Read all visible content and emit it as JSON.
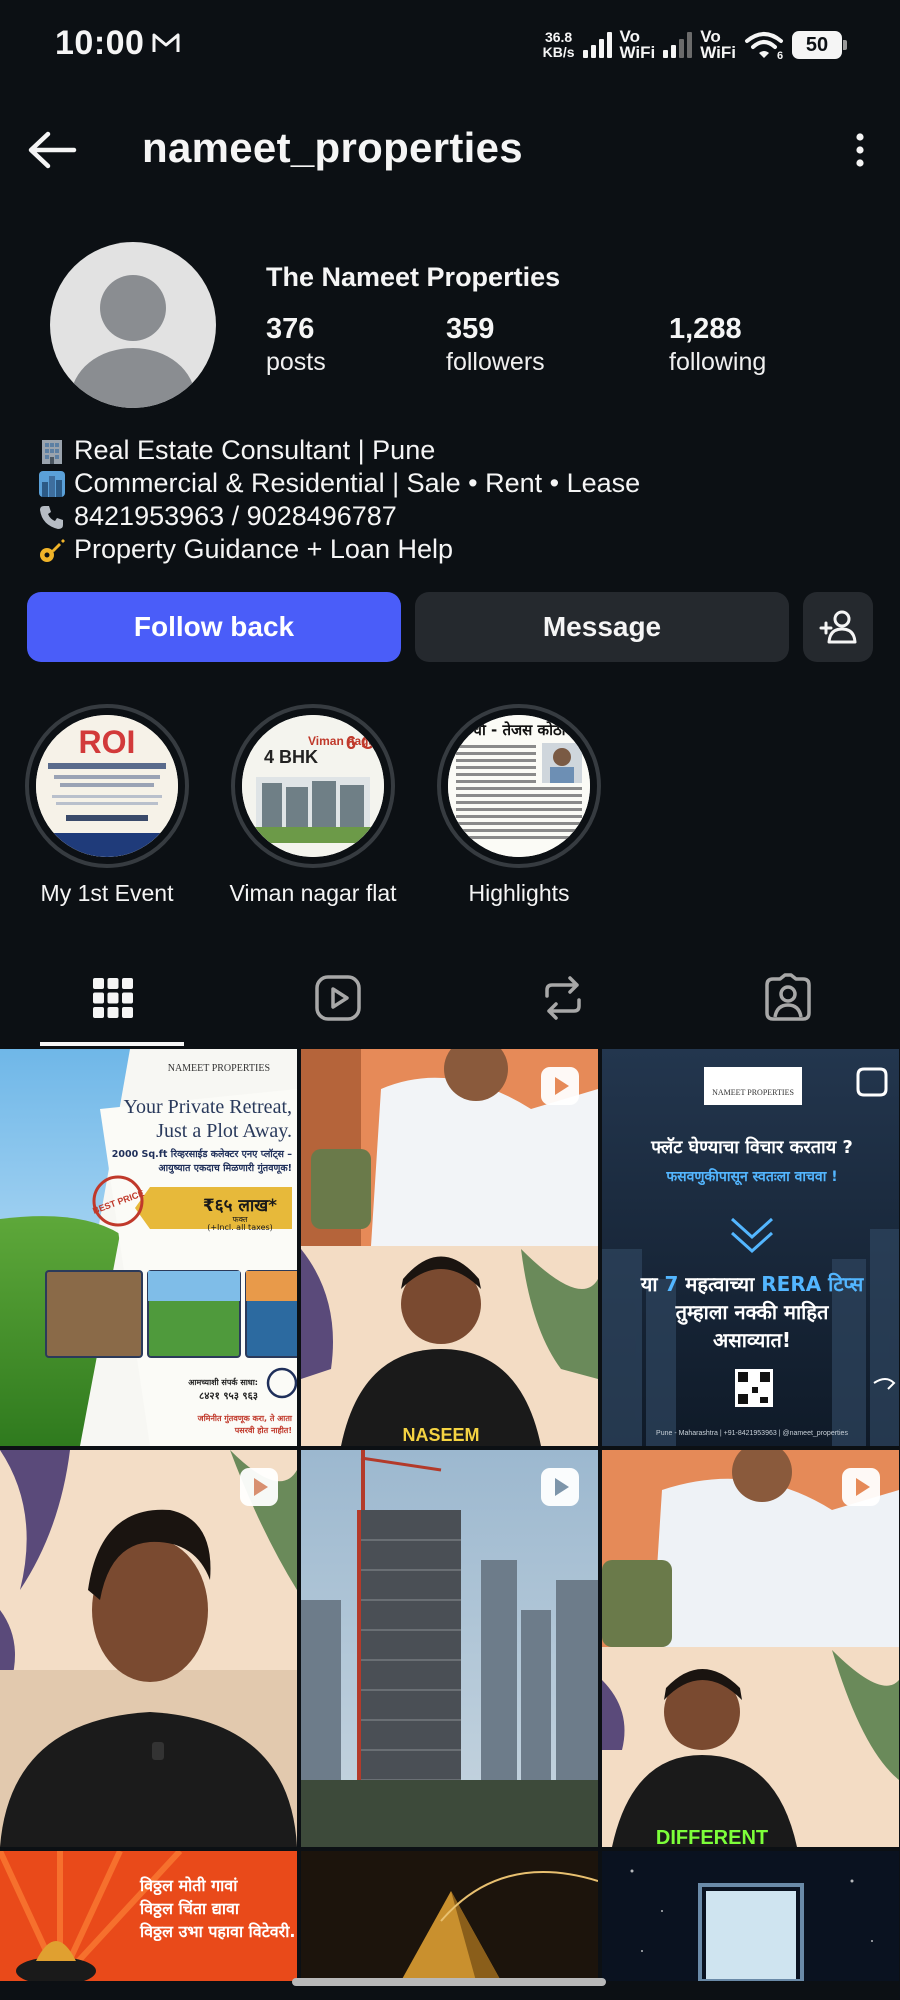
{
  "status_bar": {
    "time": "10:00",
    "net_speed_value": "36.8",
    "net_speed_unit": "KB/s",
    "vowifi_1_top": "Vo",
    "vowifi_1_bottom": "WiFi",
    "vowifi_2_top": "Vo",
    "vowifi_2_bottom": "WiFi",
    "sim2_sub": "6",
    "battery": "50"
  },
  "header": {
    "username": "nameet_properties"
  },
  "profile": {
    "display_name": "The Nameet Properties",
    "stats": [
      {
        "count": "376",
        "label": "posts"
      },
      {
        "count": "359",
        "label": "followers"
      },
      {
        "count": "1,288",
        "label": "following"
      }
    ],
    "bio": [
      {
        "emoji": "office-building-icon",
        "text": "Real Estate Consultant | Pune"
      },
      {
        "emoji": "cityscape-icon",
        "text": "Commercial & Residential | Sale • Rent • Lease"
      },
      {
        "emoji": "phone-icon",
        "text": "8421953963 / 9028496787"
      },
      {
        "emoji": "key-icon",
        "text": "Property Guidance + Loan Help"
      }
    ]
  },
  "actions": {
    "follow_back": "Follow back",
    "message": "Message"
  },
  "highlights": [
    {
      "label": "My 1st Event",
      "cover_text": "ROI"
    },
    {
      "label": "Viman nagar flat",
      "cover_text": "4 BHK",
      "cover_text_2": "Viman nagar",
      "cover_text_3": "6 Cr."
    },
    {
      "label": "Highlights",
      "cover_text": "र्चा - तेजस कोठा"
    }
  ],
  "tabs": [
    {
      "name": "grid",
      "icon": "grid-icon",
      "active": true
    },
    {
      "name": "reels",
      "icon": "reels-icon",
      "active": false
    },
    {
      "name": "reposts",
      "icon": "repost-icon",
      "active": false
    },
    {
      "name": "tagged",
      "icon": "tagged-icon",
      "active": false
    }
  ],
  "posts": {
    "p1": {
      "brand": "NAMEET PROPERTIES",
      "headline_1": "Your Private Retreat,",
      "headline_2": "Just a Plot Away.",
      "sub": "2000 Sq.ft रिव्हरसाईड कलेक्टर एनए प्लॉट्स –",
      "sub_2": "आयुष्यात एकदाच मिळणारी गुंतवणूक!",
      "price": "₹६५ लाख*",
      "price_sub": "फक्त",
      "price_note": "(+Incl. all taxes)",
      "badge": "BEST PRICE",
      "contact": "आमच्याशी संपर्क साधा:",
      "contact_num": "८४२१ ९५३ ९६३",
      "footer": "जमिनीत गुंतवणूक करा, ते आता",
      "footer_2": "पसरवी होत नाहीत!"
    },
    "p3": {
      "brand": "NAMEET PROPERTIES",
      "line1": "फ्लॅट घेण्याचा विचार करताय ?",
      "line2": "फसवणुकीपासून स्वतःला वाचवा !",
      "line3_a": "या",
      "line3_num": "7",
      "line3_b": "महत्वाच्या",
      "line3_c": "RERA",
      "line3_d": "टिप्स",
      "line4": "तुम्हाला नक्की माहित",
      "line5": "असाव्यात!",
      "footer": "Pune - Maharashtra | +91-8421953963 | @nameet_properties"
    },
    "p2": {
      "caption": "NASEEM"
    },
    "p6": {
      "caption": "DIFFERENT"
    },
    "p7": {
      "line1": "विठ्ठल मोती गावां",
      "line2": "विठ्ठल चिंता द्यावा",
      "line3": "विठ्ठल उभा पहावा विटेवरी..."
    }
  },
  "colors": {
    "background": "#0c1014",
    "follow_button": "#4a5df9",
    "secondary_button": "#25292e",
    "text": "#f5f5f5",
    "rera_highlight": "#3fa9ff",
    "different_caption": "#7dff3a"
  }
}
